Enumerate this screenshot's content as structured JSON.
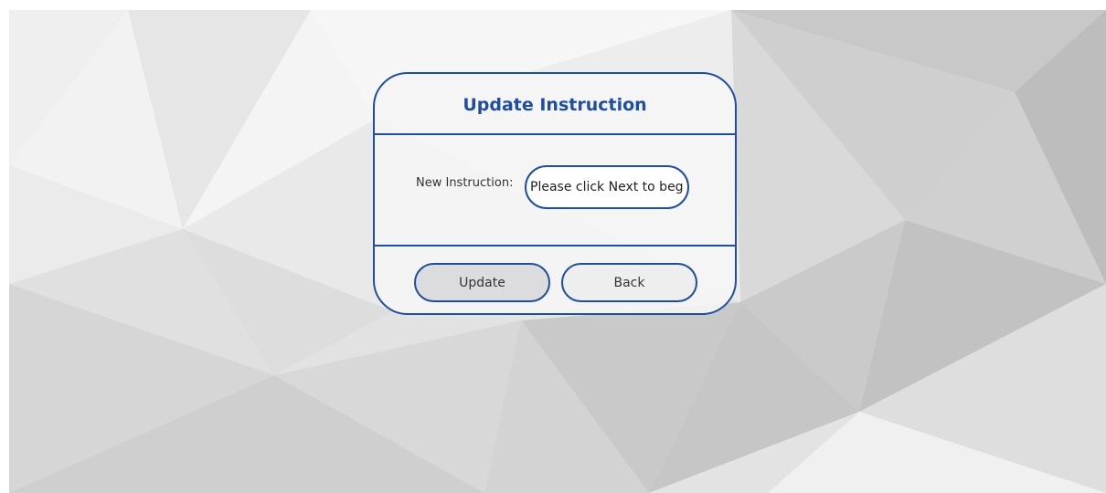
{
  "dialog": {
    "title": "Update Instruction",
    "field_label": "New Instruction:",
    "field_value": "Please click Next to begi",
    "update_label": "Update",
    "back_label": "Back"
  },
  "colors": {
    "accent": "#1f4e9e",
    "background": "#e4e4e4"
  }
}
